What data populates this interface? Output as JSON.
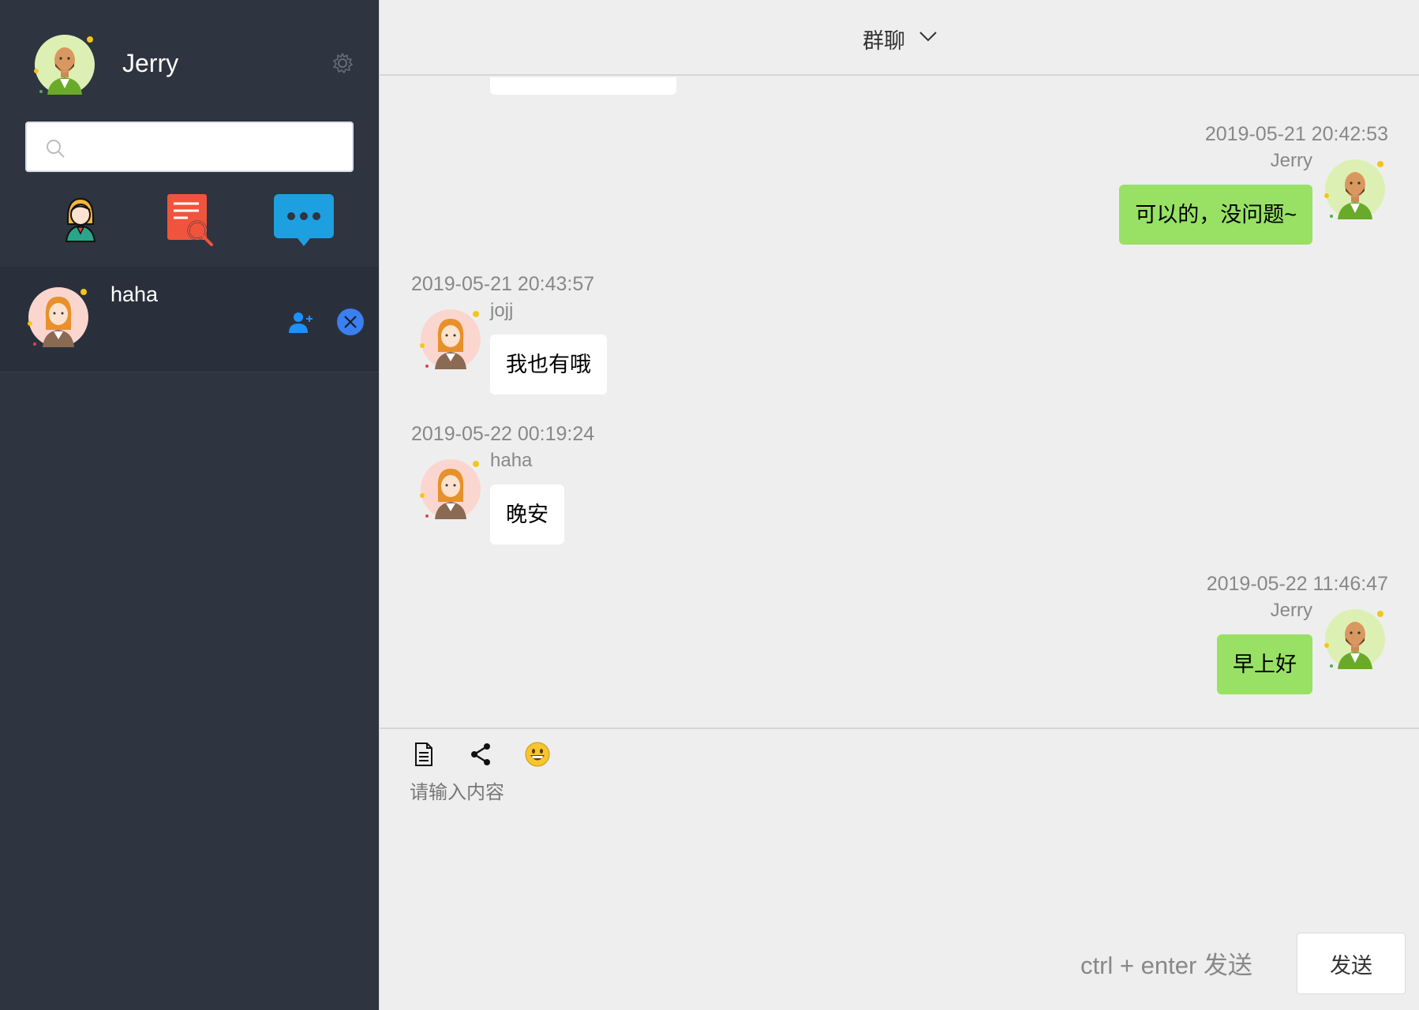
{
  "profile": {
    "username": "Jerry"
  },
  "search": {
    "placeholder": ""
  },
  "nav": {
    "icons": [
      "contacts-icon",
      "search-document-icon",
      "chat-bubble-icon"
    ]
  },
  "sessions": [
    {
      "name": "haha"
    }
  ],
  "header": {
    "title": "群聊"
  },
  "messages": [
    {
      "time": "2019-05-21 20:42:53",
      "sender": "Jerry",
      "text": "可以的，没问题~",
      "side": "right"
    },
    {
      "time": "2019-05-21 20:43:57",
      "sender": "jojj",
      "text": "我也有哦",
      "side": "left"
    },
    {
      "time": "2019-05-22 00:19:24",
      "sender": "haha",
      "text": "晚安",
      "side": "left"
    },
    {
      "time": "2019-05-22 11:46:47",
      "sender": "Jerry",
      "text": "早上好",
      "side": "right"
    }
  ],
  "composer": {
    "placeholder": "请输入内容",
    "hint": "ctrl + enter 发送",
    "send_label": "发送",
    "tools": [
      "file-icon",
      "share-icon",
      "emoji-icon"
    ]
  },
  "colors": {
    "sidebar_bg": "#2e3440",
    "main_bg": "#eeeeee",
    "my_bubble": "#98e165",
    "their_bubble": "#ffffff",
    "close_button": "#3b7ff0",
    "add_user_icon": "#1e90ff"
  }
}
